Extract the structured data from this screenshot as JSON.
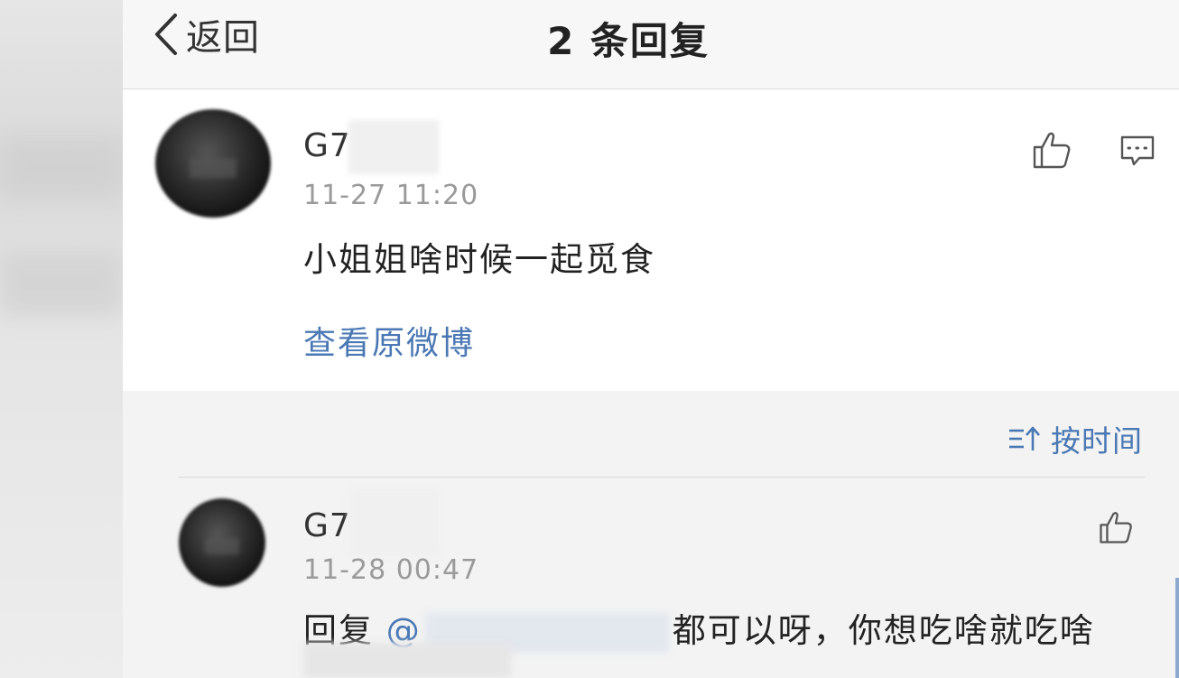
{
  "nav": {
    "back_label": "返回",
    "title": "2 条回复"
  },
  "comment": {
    "username": "G7",
    "time": "11-27 11:20",
    "text": "小姐姐啥时候一起觅食",
    "view_original": "查看原微博",
    "icons": [
      "thumbs-up-icon",
      "comment-icon"
    ]
  },
  "sort": {
    "label": "按时间",
    "icon": "sort-ascending-icon"
  },
  "reply": {
    "username": "G7",
    "time": "11-28 00:47",
    "prefix": "回复 ",
    "mention": "@",
    "text": "都可以呀，你想吃啥就吃啥",
    "icons": [
      "thumbs-up-icon"
    ]
  },
  "colors": {
    "link": "#4a78b4",
    "background": "#f3f3f3",
    "card": "#ffffff"
  }
}
